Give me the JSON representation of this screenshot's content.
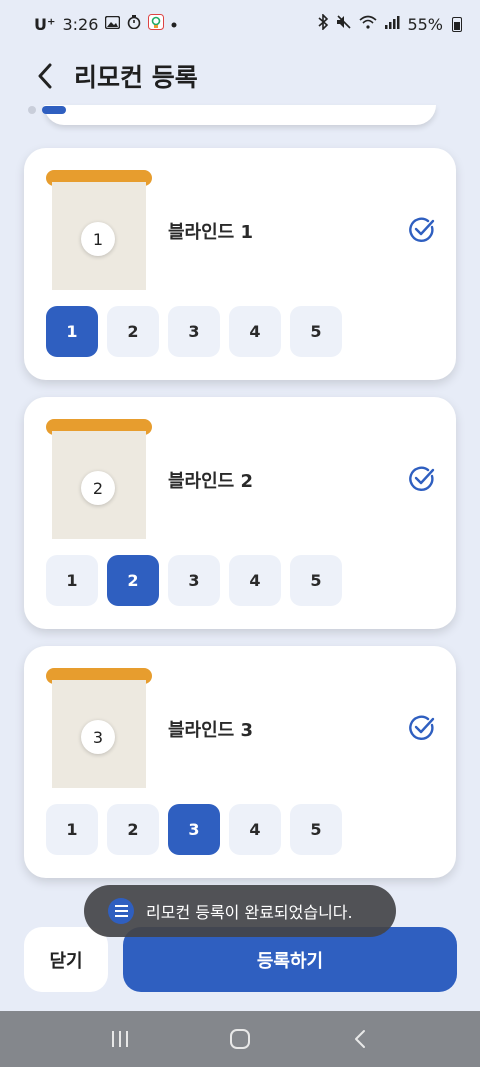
{
  "status_bar": {
    "carrier": "U⁺",
    "time": "3:26",
    "battery": "55%",
    "icons": [
      "gallery-icon",
      "timer-icon",
      "app-icon",
      "dot-icon",
      "bluetooth-icon",
      "mute-icon",
      "wifi-icon",
      "signal-icon",
      "battery-icon"
    ]
  },
  "header": {
    "title": "리모컨 등록",
    "back_icon": "chevron-left-icon"
  },
  "pager": {
    "count": 2,
    "active_index": 1
  },
  "blinds": [
    {
      "number": "1",
      "name": "블라인드 1",
      "checked": true,
      "selected_channel": "1"
    },
    {
      "number": "2",
      "name": "블라인드 2",
      "checked": true,
      "selected_channel": "2"
    },
    {
      "number": "3",
      "name": "블라인드 3",
      "checked": true,
      "selected_channel": "3"
    }
  ],
  "channels": [
    "1",
    "2",
    "3",
    "4",
    "5"
  ],
  "toast": {
    "text": "리모컨 등록이 완료되었습니다.",
    "icon": "list-icon"
  },
  "buttons": {
    "close_label": "닫기",
    "register_label": "등록하기"
  },
  "nav_bar": {
    "icons": [
      "recent-apps-icon",
      "home-icon",
      "back-icon"
    ]
  },
  "colors": {
    "accent": "#2f5fc0",
    "rail": "#e79d2e",
    "background": "#e7ecf7"
  }
}
